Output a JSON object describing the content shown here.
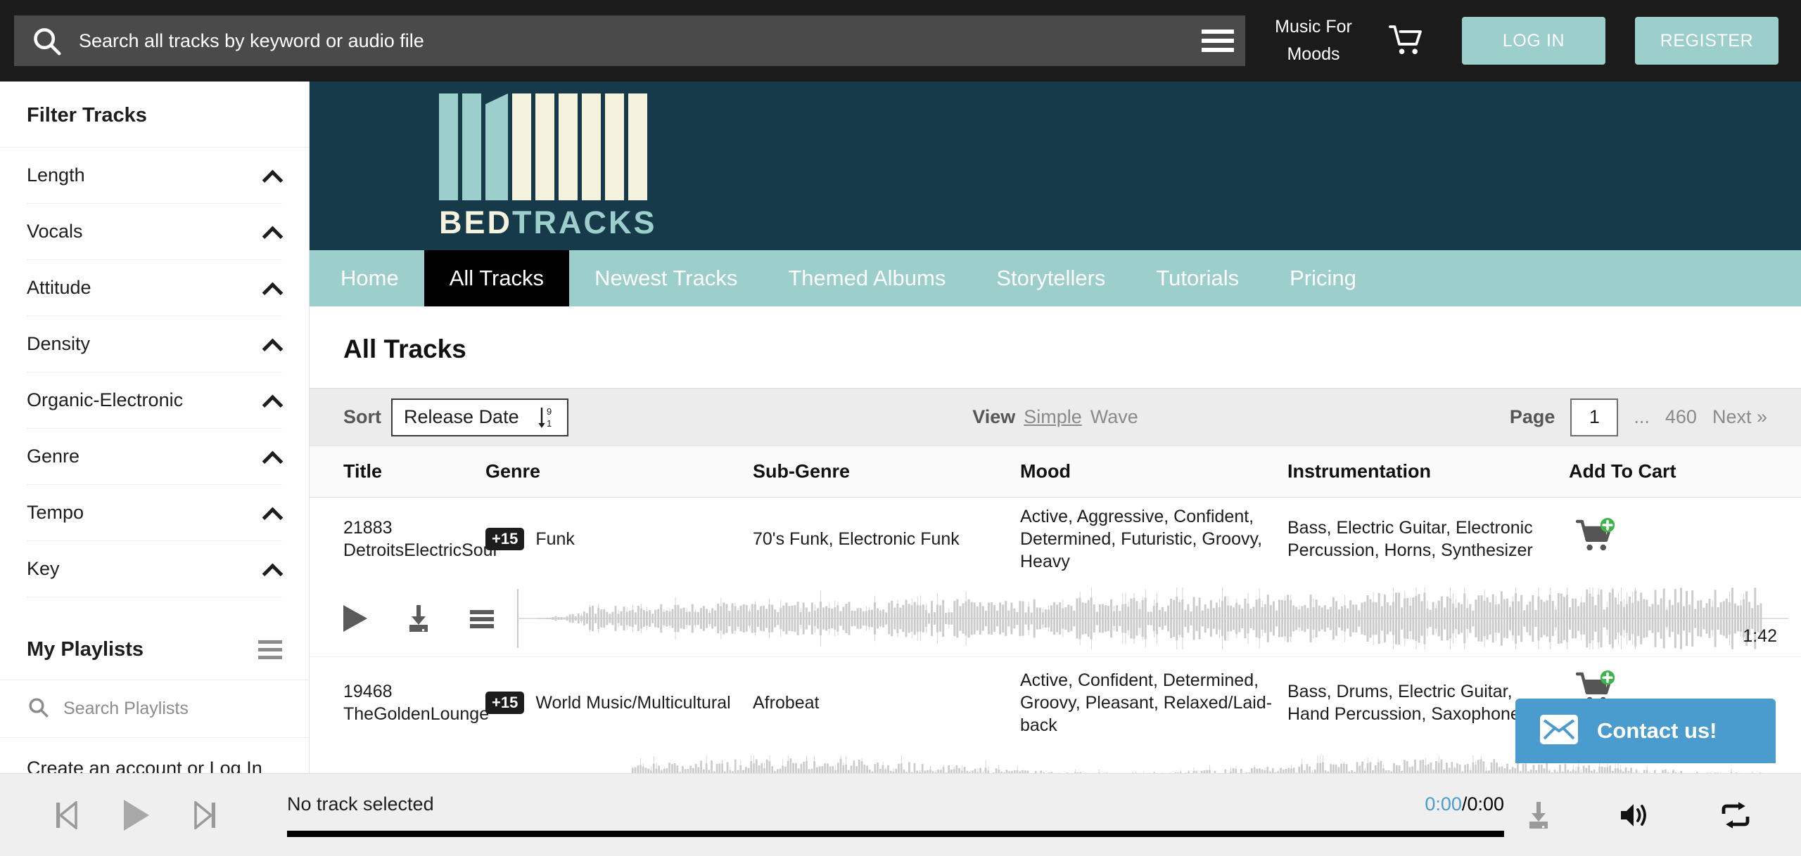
{
  "topbar": {
    "search_placeholder": "Search all tracks by keyword or audio file",
    "search_value": "",
    "search_icon": "search-icon",
    "menu_icon": "hamburger-menu-icon",
    "music_for_moods_line1": "Music For",
    "music_for_moods_line2": "Moods",
    "cart_icon": "shopping-cart-icon",
    "login_label": "LOG IN",
    "register_label": "REGISTER",
    "accent_color": "#9ccfcc",
    "bar_color": "#1b1b1b"
  },
  "sidebar": {
    "title": "Filter Tracks",
    "filters": [
      {
        "label": "Length",
        "icon": "chevron-up-icon"
      },
      {
        "label": "Vocals",
        "icon": "chevron-up-icon"
      },
      {
        "label": "Attitude",
        "icon": "chevron-up-icon"
      },
      {
        "label": "Density",
        "icon": "chevron-up-icon"
      },
      {
        "label": "Organic-Electronic",
        "icon": "chevron-up-icon"
      },
      {
        "label": "Genre",
        "icon": "chevron-up-icon"
      },
      {
        "label": "Tempo",
        "icon": "chevron-up-icon"
      },
      {
        "label": "Key",
        "icon": "chevron-up-icon"
      }
    ],
    "playlists_title": "My Playlists",
    "playlists_menu_icon": "hamburger-menu-icon",
    "playlists_search_placeholder": "Search Playlists",
    "playlists_search_value": "",
    "playlists_search_icon": "search-icon",
    "playlists_cta": "Create an account or Log In"
  },
  "brand": {
    "name_part1": "BED",
    "name_part2": "TRACKS",
    "bar_bg": "#173a4a",
    "cream": "#f5f2dd",
    "teal": "#9ccfcc"
  },
  "nav": {
    "items": [
      {
        "label": "Home",
        "active": false
      },
      {
        "label": "All Tracks",
        "active": true
      },
      {
        "label": "Newest Tracks",
        "active": false
      },
      {
        "label": "Themed Albums",
        "active": false
      },
      {
        "label": "Storytellers",
        "active": false
      },
      {
        "label": "Tutorials",
        "active": false
      },
      {
        "label": "Pricing",
        "active": false
      }
    ]
  },
  "page": {
    "heading": "All Tracks"
  },
  "toolbar": {
    "sort_label": "Sort",
    "sort_value": "Release Date",
    "sort_direction_icon": "sort-descending-9-to-1-icon",
    "sort_dir_top": "9",
    "sort_dir_bottom": "1",
    "view_label": "View",
    "view_simple": "Simple",
    "view_wave": "Wave",
    "view_selected": "Simple",
    "page_label": "Page",
    "page_value": "1",
    "page_ellipsis": "...",
    "page_last": "460",
    "page_next": "Next »"
  },
  "table": {
    "columns": [
      "Title",
      "Genre",
      "Sub-Genre",
      "Mood",
      "Instrumentation",
      "Add To Cart"
    ],
    "rows": [
      {
        "track_id": "21883",
        "track_name": "DetroitsElectricSoul",
        "genre_badge": "+15",
        "genre": "Funk",
        "subgenre": "70's Funk, Electronic Funk",
        "mood": "Active, Aggressive, Confident, Determined, Futuristic, Groovy, Heavy",
        "instrumentation": "Bass, Electric Guitar, Electronic Percussion, Horns, Synthesizer",
        "cart_icon": "add-to-cart-icon",
        "duration": "1:42",
        "play_icon": "play-icon",
        "download_icon": "download-icon",
        "menu_icon": "track-menu-icon"
      },
      {
        "track_id": "19468",
        "track_name": "TheGoldenLounge",
        "genre_badge": "+15",
        "genre": "World Music/Multicultural",
        "subgenre": "Afrobeat",
        "mood": "Active, Confident, Determined, Groovy, Pleasant, Relaxed/Laid-back",
        "instrumentation": "Bass, Drums, Electric Guitar, Hand Percussion, Saxophone",
        "cart_icon": "add-to-cart-icon",
        "duration": "",
        "play_icon": "play-icon",
        "download_icon": "download-icon",
        "menu_icon": "track-menu-icon"
      }
    ]
  },
  "contact_widget": {
    "label": "Contact us!",
    "icon": "envelope-icon",
    "color": "#4a9ccf"
  },
  "player": {
    "prev_icon": "skip-previous-icon",
    "play_icon": "play-icon",
    "next_icon": "skip-next-icon",
    "track_label": "No track selected",
    "current_time": "0:00",
    "time_separator": "/",
    "total_time": "0:00",
    "download_icon": "download-icon",
    "volume_icon": "volume-icon",
    "loop_icon": "repeat-icon",
    "progress_percent": 0
  }
}
